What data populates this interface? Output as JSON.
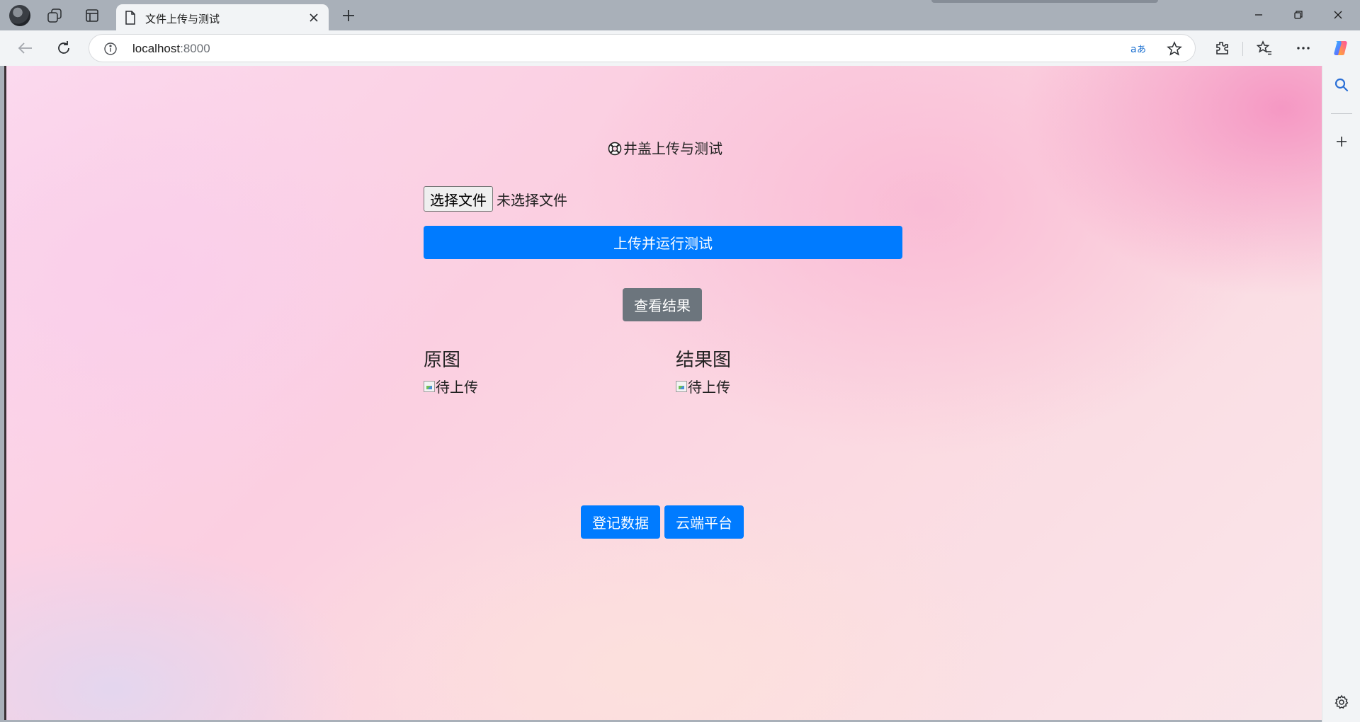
{
  "browser": {
    "tab_title": "文件上传与测试",
    "url_host": "localhost",
    "url_port": ":8000"
  },
  "page": {
    "heading": "井盖上传与测试",
    "heading_icon": "lifebuoy-icon",
    "file_input": {
      "button_label": "选择文件",
      "status": "未选择文件"
    },
    "upload_button": "上传并运行测试",
    "view_button": "查看结果",
    "original": {
      "title": "原图",
      "alt": "待上传"
    },
    "result": {
      "title": "结果图",
      "alt": "待上传"
    },
    "register_button": "登记数据",
    "cloud_button": "云端平台"
  },
  "colors": {
    "primary": "#007bff",
    "secondary": "#6c757d"
  }
}
